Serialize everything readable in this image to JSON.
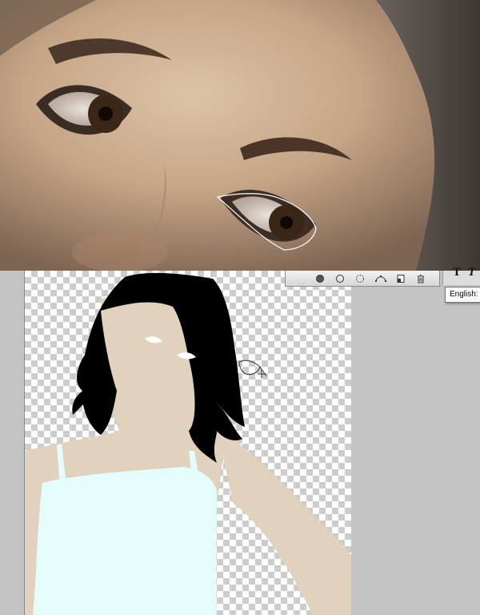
{
  "tooltip": {
    "language_label": "English: U"
  },
  "toolbar": {
    "buttons": [
      {
        "name": "fill-path-icon"
      },
      {
        "name": "stroke-path-icon"
      },
      {
        "name": "load-selection-icon"
      },
      {
        "name": "make-work-path-icon"
      },
      {
        "name": "new-path-icon"
      },
      {
        "name": "delete-path-icon"
      }
    ]
  },
  "type_tool": {
    "bold_glyph": "T",
    "italic_glyph": "T"
  },
  "colors": {
    "skin": "#e0d2bd",
    "hair": "#000000",
    "shirt": "#e5fcfc",
    "canvas_bg": "#c3c3c3",
    "path_stroke": "#ffffff"
  },
  "icons": {
    "pen-cursor": "pen-tool-cursor-icon"
  }
}
